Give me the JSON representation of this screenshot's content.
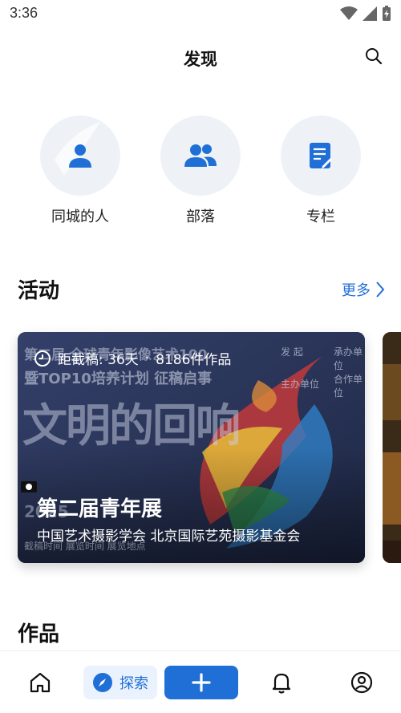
{
  "status": {
    "time": "3:36"
  },
  "header": {
    "title": "发现"
  },
  "categories": [
    {
      "label": "同城的人",
      "icon": "person-icon"
    },
    {
      "label": "部落",
      "icon": "group-icon"
    },
    {
      "label": "专栏",
      "icon": "article-icon"
    }
  ],
  "activity": {
    "section_title": "活动",
    "more_label": "更多",
    "card": {
      "deadline": "距截稿: 36天",
      "separator": "·",
      "works_count": "8186件作品",
      "title": "第二届青年展",
      "organizers": "中国艺术摄影学会 北京国际艺苑摄影基金会",
      "poster": {
        "headline_1": "第二届 全球青年影像艺术100",
        "headline_2": "暨TOP10培养计划 征稿启事",
        "big_text": "文明的回响",
        "side_1": "发 起",
        "side_2": "承办单位",
        "side_3": "主办单位",
        "side_4": "合作单位",
        "year": "2025",
        "footer": "截稿时间  展览时间  展览地点"
      }
    }
  },
  "works": {
    "section_title": "作品"
  },
  "tabbar": {
    "explore_label": "探索"
  },
  "colors": {
    "accent": "#1f6fd6",
    "circle_bg": "#eef2f7"
  }
}
